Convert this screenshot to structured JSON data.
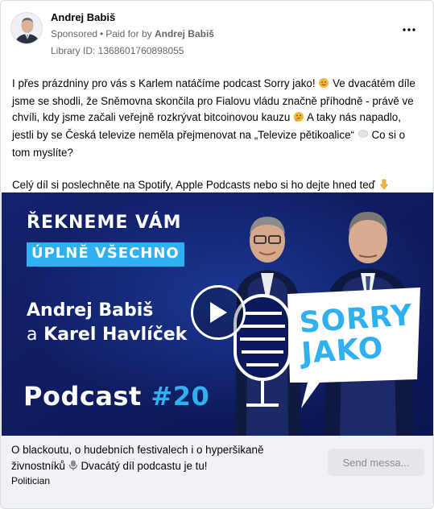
{
  "header": {
    "name": "Andrej Babiš",
    "sponsored": "Sponsored",
    "separator": "•",
    "paid_prefix": "Paid for by",
    "paid_by": "Andrej Babiš",
    "library_id": "Library ID: 1368601760898055",
    "more_icon": "more-dots-icon"
  },
  "body": {
    "para1_a": "I přes prázdniny pro vás s Karlem natáčíme podcast Sorry jako!",
    "para1_b": "Ve dvacátém díle jsme se shodli, že Sněmovna skončila pro Fialovu vládu značně příhodně - právě ve chvíli, kdy jsme začali veřejně rozkrývat bitcoinovou kauzu",
    "para1_c": "A taky nás napadlo, jestli by se Česká televize neměla přejmenovat na „Televize pětikoalice“",
    "para1_d": "Co si o tom myslíte?",
    "para2": "Celý díl si poslechněte na Spotify, Apple Podcasts nebo si ho dejte hned teď",
    "emojis": [
      "sun-face-emoji",
      "thinking-face-emoji",
      "speech-bubble-emoji",
      "pointing-down-emoji"
    ]
  },
  "media": {
    "headline1": "ŘEKNEME VÁM",
    "headline2": "ÚPLNĚ VŠECHNO",
    "name1": "Andrej Babiš",
    "name2_a": "a",
    "name2_b": "Karel Havlíček",
    "podcast_word": "Podcast",
    "podcast_num": "#20",
    "logo_line1": "SORRY",
    "logo_line2": "JAKO",
    "colors": {
      "bg": "#0c1a5c",
      "accent": "#2fb0f0"
    },
    "play_icon": "play-icon"
  },
  "footer": {
    "caption_a": "O blackoutu, o hudebních festivalech i o hyperšikaně živnostníků",
    "caption_b": "Dvacátý díl podcastu je tu!",
    "category": "Politician",
    "send_button": "Send messa..."
  }
}
